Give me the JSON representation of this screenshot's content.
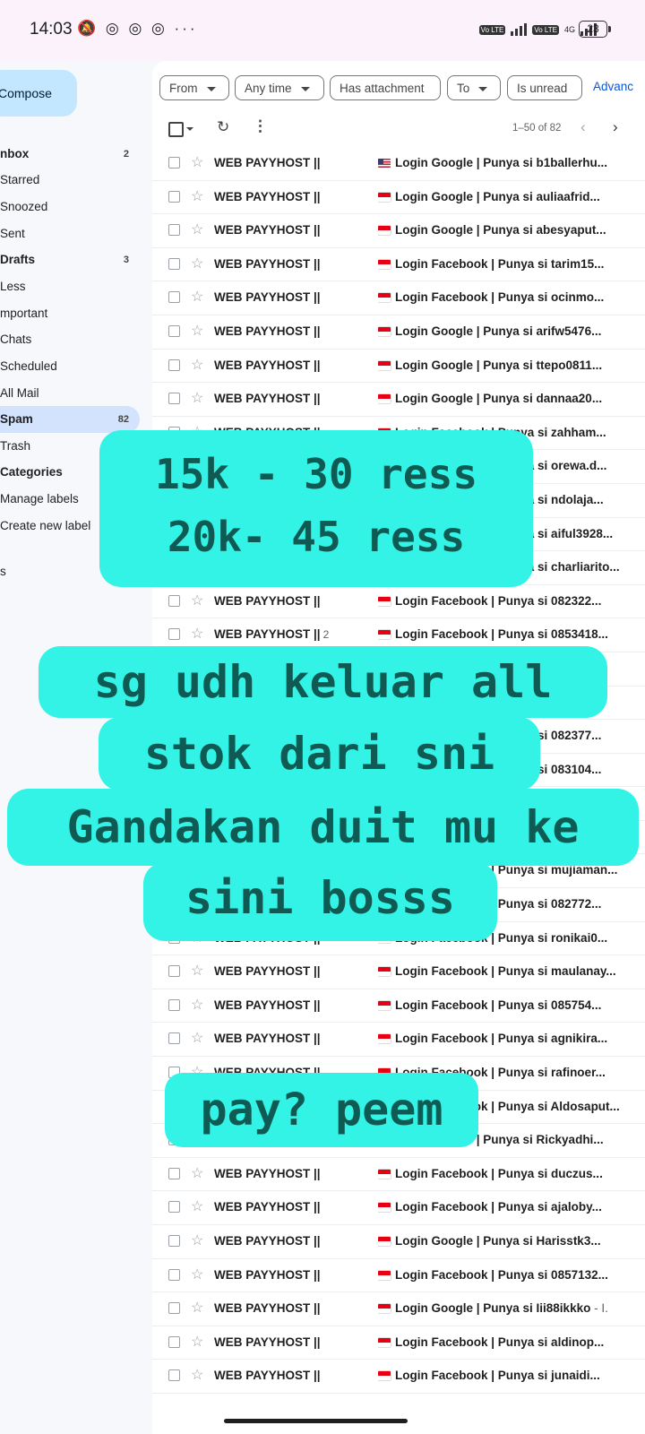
{
  "status_bar": {
    "time": "14:03",
    "notification_icons": "🔕 ◎ ◎ ◎  ···",
    "network": "4G",
    "battery": "23",
    "volte_label": "Vo LTE"
  },
  "sidebar": {
    "compose_label": "Compose",
    "items": [
      {
        "label": "nbox",
        "count": "2",
        "bold": true
      },
      {
        "label": "Starred",
        "count": ""
      },
      {
        "label": "Snoozed",
        "count": ""
      },
      {
        "label": "Sent",
        "count": ""
      },
      {
        "label": "Drafts",
        "count": "3",
        "bold": true
      },
      {
        "label": "Less",
        "count": ""
      },
      {
        "label": "mportant",
        "count": ""
      },
      {
        "label": "Chats",
        "count": ""
      },
      {
        "label": "Scheduled",
        "count": ""
      },
      {
        "label": "All Mail",
        "count": ""
      },
      {
        "label": "Spam",
        "count": "82",
        "bold": true,
        "active": true
      },
      {
        "label": "Trash",
        "count": ""
      },
      {
        "label": "Categories",
        "count": "",
        "bold": true
      },
      {
        "label": "Manage labels",
        "count": ""
      },
      {
        "label": "Create new label",
        "count": ""
      },
      {
        "label": "s",
        "count": ""
      }
    ]
  },
  "filters": {
    "from": "From",
    "any_time": "Any time",
    "has_attachment": "Has attachment",
    "to": "To",
    "is_unread": "Is unread",
    "advanced": "Advanc"
  },
  "toolbar": {
    "range": "1–50 of 82"
  },
  "emails": [
    {
      "sender": "WEB PAYYHOST ||",
      "count": "",
      "flag": "us",
      "subject": "Login Google | Punya si b1ballerhu..."
    },
    {
      "sender": "WEB PAYYHOST ||",
      "count": "",
      "flag": "id",
      "subject": "Login Google | Punya si auliaafrid..."
    },
    {
      "sender": "WEB PAYYHOST ||",
      "count": "",
      "flag": "id",
      "subject": "Login Google | Punya si abesyaput..."
    },
    {
      "sender": "WEB PAYYHOST ||",
      "count": "",
      "flag": "id",
      "subject": "Login Facebook | Punya si tarim15..."
    },
    {
      "sender": "WEB PAYYHOST ||",
      "count": "",
      "flag": "id",
      "subject": "Login Facebook | Punya si ocinmo..."
    },
    {
      "sender": "WEB PAYYHOST ||",
      "count": "",
      "flag": "id",
      "subject": "Login Google | Punya si arifw5476..."
    },
    {
      "sender": "WEB PAYYHOST ||",
      "count": "",
      "flag": "id",
      "subject": "Login Google | Punya si ttepo0811..."
    },
    {
      "sender": "WEB PAYYHOST ||",
      "count": "",
      "flag": "id",
      "subject": "Login Google | Punya si dannaa20..."
    },
    {
      "sender": "WEB PAYYHOST ||",
      "count": "",
      "flag": "id",
      "subject": "Login Facebook | Punya si zahham..."
    },
    {
      "sender": "WEB PAYYHOST ||",
      "count": "",
      "flag": "id",
      "subject": "Login Facebook | Punya si orewa.d..."
    },
    {
      "sender": "WEB PAYYHOST ||",
      "count": "",
      "flag": "id",
      "subject": "Login Facebook | Punya si ndolaja..."
    },
    {
      "sender": "WEB PAYYHOST ||",
      "count": "",
      "flag": "id",
      "subject": "Login Facebook | Punya si aiful3928..."
    },
    {
      "sender": "WEB PAYYHOST ||",
      "count": "",
      "flag": "id",
      "subject": "Login Facebook | Punya si charliarito..."
    },
    {
      "sender": "WEB PAYYHOST ||",
      "count": "",
      "flag": "id",
      "subject": "Login Facebook | Punya si 082322..."
    },
    {
      "sender": "WEB PAYYHOST ||",
      "count": "2",
      "flag": "id",
      "subject": "Login Facebook | Punya si 0853418..."
    },
    {
      "sender": "WEB PAYYHOST ||",
      "count": "",
      "flag": "id",
      "subject": ""
    },
    {
      "sender": "WEB PAYYHOST ||",
      "count": "",
      "flag": "id",
      "subject": ""
    },
    {
      "sender": "WEB PAYYHOST ||",
      "count": "",
      "flag": "id",
      "subject": "Login Facebook | Punya si 082377..."
    },
    {
      "sender": "WEB PAYYHOST ||",
      "count": "",
      "flag": "id",
      "subject": "Login Facebook | Punya si 083104..."
    },
    {
      "sender": "WEB PAYYHOST ||",
      "count": "",
      "flag": "id",
      "subject": ""
    },
    {
      "sender": "WEB PAYYHOST ||",
      "count": "",
      "flag": "id",
      "subject": ""
    },
    {
      "sender": "WEB PAYYHOST ||",
      "count": "",
      "flag": "id",
      "subject": "Login Facebook | Punya si mujiaman..."
    },
    {
      "sender": "WEB PAYYHOST ||",
      "count": "",
      "flag": "id",
      "subject": "Login Facebook | Punya si 082772..."
    },
    {
      "sender": "WEB PAYYHOST ||",
      "count": "",
      "flag": "id",
      "subject": "Login Facebook | Punya si ronikai0..."
    },
    {
      "sender": "WEB PAYYHOST ||",
      "count": "",
      "flag": "id",
      "subject": "Login Facebook | Punya si maulanay..."
    },
    {
      "sender": "WEB PAYYHOST ||",
      "count": "",
      "flag": "id",
      "subject": "Login Facebook | Punya si 085754..."
    },
    {
      "sender": "WEB PAYYHOST ||",
      "count": "",
      "flag": "id",
      "subject": "Login Facebook | Punya si agnikira..."
    },
    {
      "sender": "WEB PAYYHOST ||",
      "count": "",
      "flag": "id",
      "subject": "Login Facebook | Punya si rafinoer..."
    },
    {
      "sender": "WEB PAYYHOST ||",
      "count": "",
      "flag": "id",
      "subject": "Login Facebook | Punya si Aldosaput..."
    },
    {
      "sender": "WEB PAYYHOST ||",
      "count": "2",
      "flag": "id",
      "subject": "Login Google | Punya si Rickyadhi..."
    },
    {
      "sender": "WEB PAYYHOST ||",
      "count": "",
      "flag": "id",
      "subject": "Login Facebook | Punya si duczus..."
    },
    {
      "sender": "WEB PAYYHOST ||",
      "count": "",
      "flag": "id",
      "subject": "Login Facebook | Punya si ajaloby..."
    },
    {
      "sender": "WEB PAYYHOST ||",
      "count": "",
      "flag": "id",
      "subject": "Login Google | Punya si Harisstk3..."
    },
    {
      "sender": "WEB PAYYHOST ||",
      "count": "",
      "flag": "id",
      "subject": "Login Facebook | Punya si 0857132..."
    },
    {
      "sender": "WEB PAYYHOST ||",
      "count": "",
      "flag": "id",
      "subject": "Login Google | Punya si Iii88ikkko",
      "snippet": " - I."
    },
    {
      "sender": "WEB PAYYHOST ||",
      "count": "",
      "flag": "id",
      "subject": "Login Facebook | Punya si aldinop..."
    },
    {
      "sender": "WEB PAYYHOST ||",
      "count": "",
      "flag": "id",
      "subject": "Login Facebook | Punya si junaidi..."
    }
  ],
  "overlays": {
    "price_line1": "15k - 30 ress",
    "price_line2": "20k- 45 ress",
    "promo_line1": "sg udh keluar all",
    "promo_line2": "stok dari sni",
    "promo_line3": "Gandakan duit mu ke",
    "promo_line4": "sini bosss",
    "pay_line": "pay? peem"
  }
}
